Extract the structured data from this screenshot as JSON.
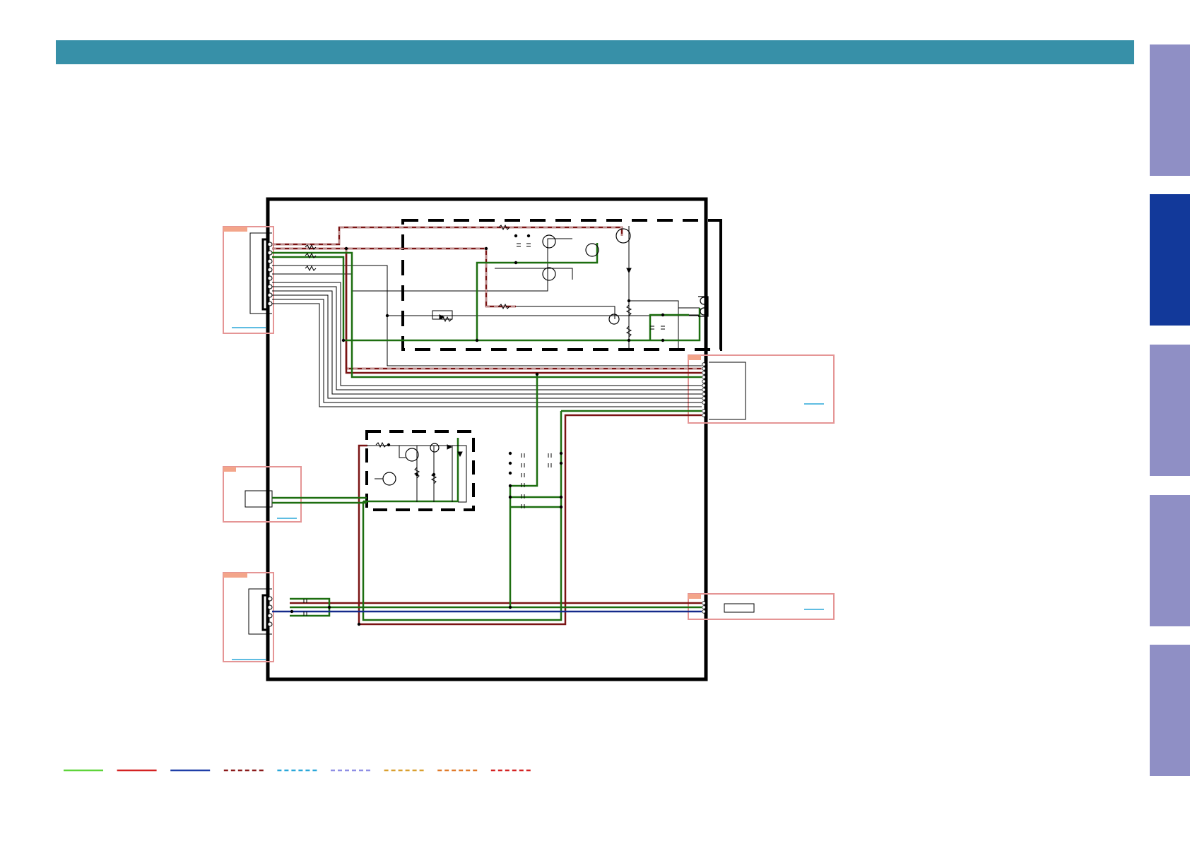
{
  "colors": {
    "header_bar": "#3790a8",
    "tab_inactive": "#8f8fc5",
    "tab_active": "#12399a",
    "wire_green": "#1d6e10",
    "wire_dark_red": "#7a1414",
    "wire_blue": "#142a8a",
    "ref_box": "#e59595",
    "ref_box_fill": "#f3a58a",
    "link": "#2aa7d9"
  },
  "side_tabs": [
    {
      "name": "side-tab-1",
      "state": "inactive"
    },
    {
      "name": "side-tab-2",
      "state": "active"
    },
    {
      "name": "side-tab-3",
      "state": "inactive"
    },
    {
      "name": "side-tab-4",
      "state": "inactive"
    },
    {
      "name": "side-tab-5",
      "state": "inactive"
    }
  ],
  "legend": [
    {
      "name": "legend-line-green-solid",
      "color": "#5fd43a",
      "style": "solid"
    },
    {
      "name": "legend-line-red-solid",
      "color": "#d42222",
      "style": "solid"
    },
    {
      "name": "legend-line-blue-solid",
      "color": "#1f3fa8",
      "style": "solid"
    },
    {
      "name": "legend-line-dark-red-dashed",
      "color": "#8a1a1a",
      "style": "dashed"
    },
    {
      "name": "legend-line-cyan-dashed",
      "color": "#2aa7d9",
      "style": "dashed"
    },
    {
      "name": "legend-line-lavender-dashed",
      "color": "#8f8fe5",
      "style": "dashed"
    },
    {
      "name": "legend-line-amber-dashed",
      "color": "#d9a030",
      "style": "dashed"
    },
    {
      "name": "legend-line-orange-dashed",
      "color": "#e07a2a",
      "style": "dashed"
    },
    {
      "name": "legend-line-red-dashed",
      "color": "#d42222",
      "style": "dashed"
    }
  ]
}
